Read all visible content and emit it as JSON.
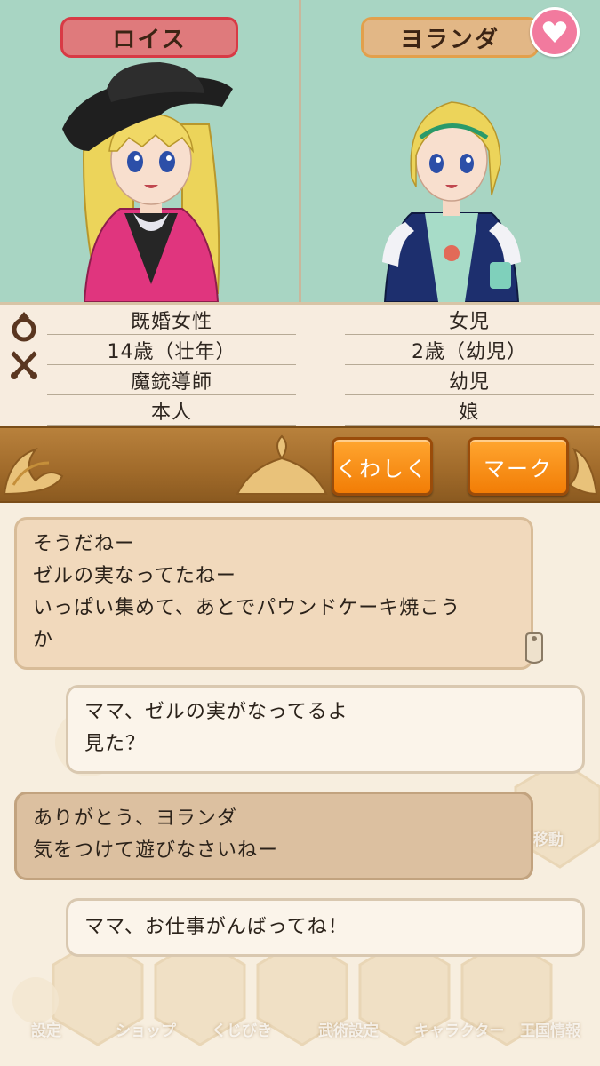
{
  "characters": {
    "left": {
      "name": "ロイス",
      "info": [
        "既婚女性",
        "14歳（壮年）",
        "魔銃導師",
        "本人"
      ]
    },
    "right": {
      "name": "ヨランダ",
      "info": [
        "女児",
        "2歳（幼児）",
        "幼児",
        "娘"
      ]
    }
  },
  "actions": {
    "detail_label": "くわしく",
    "mark_label": "マーク"
  },
  "chat": {
    "messages": [
      {
        "side": "in",
        "lines": [
          "そうだねー",
          "ゼルの実なってたねー",
          "いっぱい集めて、あとでパウンドケーキ焼こう",
          "か"
        ]
      },
      {
        "side": "out",
        "lines": [
          "ママ、ゼルの実がなってるよ",
          "見た？"
        ]
      },
      {
        "side": "in",
        "lines": [
          "ありがとう、ヨランダ",
          "気をつけて遊びなさいねー"
        ]
      },
      {
        "side": "out",
        "lines": [
          "ママ、お仕事がんばってね！"
        ]
      }
    ]
  },
  "background_menu": {
    "items": [
      "設定",
      "ショップ",
      "くじびき",
      "武術設定",
      "キャラクター",
      "王国情報",
      "移動"
    ]
  },
  "colors": {
    "portrait_bg": "#a8d5c3",
    "left_tag": "#df7a7c",
    "right_tag": "#e2b786",
    "button_orange": "#f27d06",
    "heart": "#f27a9e"
  },
  "icons": {
    "ring": "ring-icon",
    "swords": "crossed-swords-icon",
    "heart": "heart-icon",
    "pin": "pin-icon"
  }
}
